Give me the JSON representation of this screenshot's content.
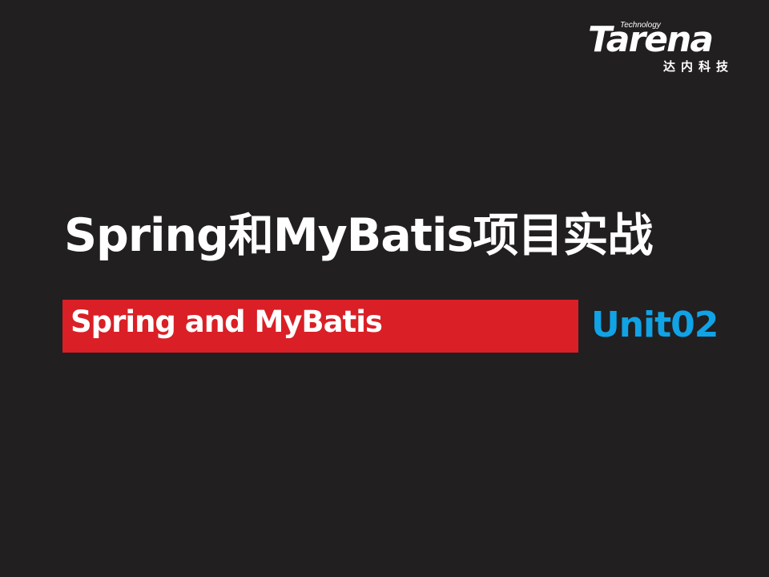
{
  "logo": {
    "technology_text": "Technology",
    "brand_text": "Tarena",
    "chinese_text": "达内科技"
  },
  "slide": {
    "title": "Spring和MyBatis项目实战",
    "subtitle": "Spring and MyBatis",
    "unit": "Unit02"
  },
  "colors": {
    "background": "#221f20",
    "banner_red": "#da1f26",
    "unit_blue": "#10a3e6",
    "text_white": "#ffffff"
  }
}
